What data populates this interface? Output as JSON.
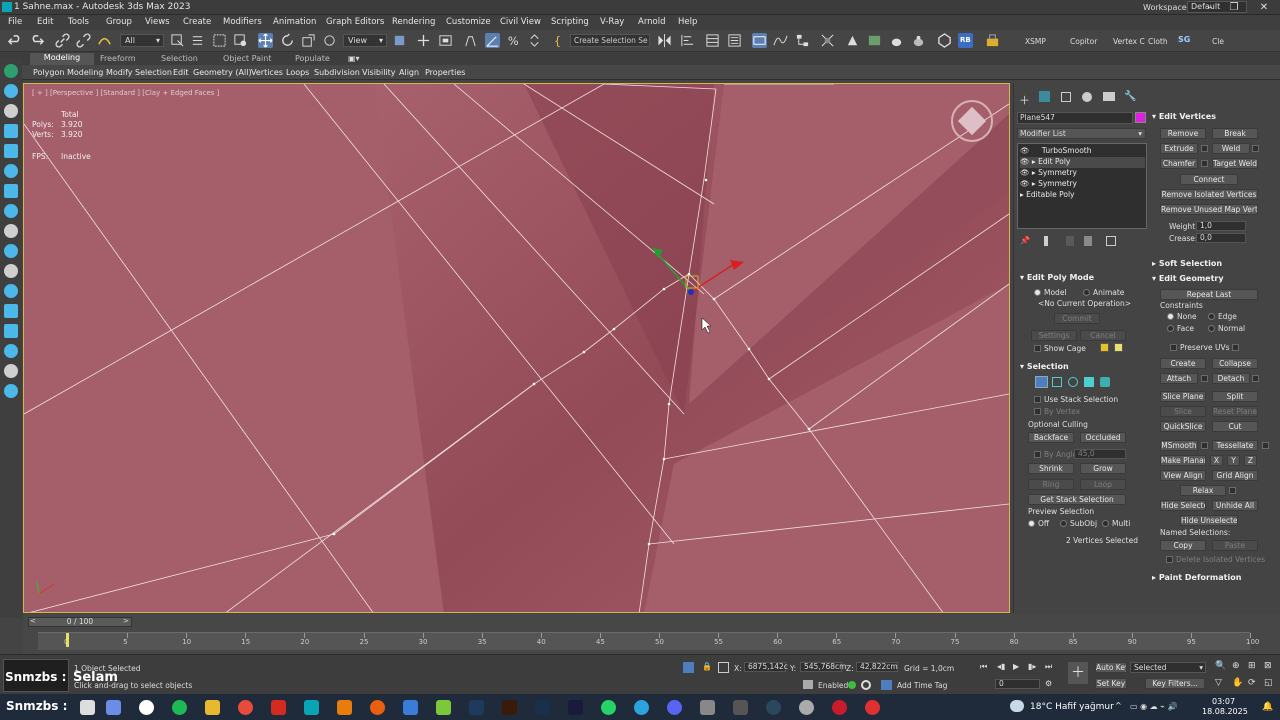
{
  "window": {
    "title": "1 Sahne.max - Autodesk 3ds Max 2023",
    "workspaces_label": "Workspaces:",
    "workspace_value": "Default"
  },
  "menu": [
    "File",
    "Edit",
    "Tools",
    "Group",
    "Views",
    "Create",
    "Modifiers",
    "Animation",
    "Graph Editors",
    "Rendering",
    "Customize",
    "Civil View",
    "Scripting",
    "V-Ray",
    "Arnold",
    "Help"
  ],
  "toolbar": {
    "filter_value": "All",
    "view_value": "View",
    "selection_set_placeholder": "Create Selection Se",
    "xsmp": "XSMP",
    "copitor": "Copitor",
    "vertex": "Vertex C",
    "cloth": "Cloth",
    "cle": "Cle",
    "rb": "RB"
  },
  "ribbon_tabs": [
    "Modeling",
    "Freeform",
    "Selection",
    "Object Paint",
    "Populate"
  ],
  "ribbon_sub": [
    "Polygon Modeling",
    "Modify Selection",
    "Edit",
    "Geometry (All)",
    "Vertices",
    "Loops",
    "Subdivision",
    "Visibility",
    "Align",
    "Properties"
  ],
  "viewport": {
    "label": "[ + ] [Perspective ] [Standard ] [Clay + Edged Faces ]",
    "total_label": "Total",
    "polys_label": "Polys:",
    "polys_value": "3.920",
    "verts_label": "Verts:",
    "verts_value": "3.920",
    "fps_label": "FPS:",
    "fps_value": "Inactive",
    "bg_color": "#a05a66"
  },
  "command_panel": {
    "object_name": "Plane547",
    "object_color": "#e020e0",
    "modifier_list": "Modifier List",
    "stack": [
      "TurboSmooth",
      "Edit Poly",
      "Symmetry",
      "Symmetry",
      "Editable Poly"
    ],
    "edit_poly_mode": {
      "title": "Edit Poly Mode",
      "model": "Model",
      "animate": "Animate",
      "current_op": "<No Current Operation>",
      "commit": "Commit",
      "settings": "Settings",
      "cancel": "Cancel",
      "show_cage": "Show Cage"
    },
    "selection": {
      "title": "Selection",
      "use_stack": "Use Stack Selection",
      "by_vertex": "By Vertex",
      "optional_culling": "Optional Culling",
      "backface": "Backface",
      "occluded": "Occluded",
      "by_angle": "By Angle:",
      "by_angle_value": "45,0",
      "shrink": "Shrink",
      "grow": "Grow",
      "ring": "Ring",
      "loop": "Loop",
      "get_stack": "Get Stack Selection",
      "preview": "Preview Selection",
      "off": "Off",
      "subobj": "SubObj",
      "multi": "Multi",
      "status": "2 Vertices Selected"
    }
  },
  "rollouts": {
    "edit_vertices": {
      "title": "Edit Vertices",
      "remove": "Remove",
      "break": "Break",
      "extrude": "Extrude",
      "weld": "Weld",
      "chamfer": "Chamfer",
      "target_weld": "Target Weld",
      "connect": "Connect",
      "remove_isolated": "Remove Isolated Vertices",
      "remove_unused": "Remove Unused Map Verts",
      "weight_label": "Weight:",
      "weight_value": "1,0",
      "crease_label": "Crease:",
      "crease_value": "0,0"
    },
    "soft_selection": "Soft Selection",
    "edit_geometry": {
      "title": "Edit Geometry",
      "repeat_last": "Repeat Last",
      "constraints": "Constraints",
      "none": "None",
      "edge": "Edge",
      "face": "Face",
      "normal": "Normal",
      "preserve_uvs": "Preserve UVs",
      "create": "Create",
      "collapse": "Collapse",
      "attach": "Attach",
      "detach": "Detach",
      "slice_plane": "Slice Plane",
      "split": "Split",
      "slice": "Slice",
      "reset_plane": "Reset Plane",
      "quickslice": "QuickSlice",
      "cut": "Cut",
      "msmooth": "MSmooth",
      "tessellate": "Tessellate",
      "make_planar": "Make Planar",
      "x": "X",
      "y": "Y",
      "z": "Z",
      "view_align": "View Align",
      "grid_align": "Grid Align",
      "relax": "Relax",
      "hide_selected": "Hide Selected",
      "unhide_all": "Unhide All",
      "hide_unselected": "Hide Unselected",
      "named_selections": "Named Selections:",
      "copy": "Copy",
      "paste": "Paste",
      "delete_isolated": "Delete Isolated Vertices"
    },
    "paint_deformation": "Paint Deformation"
  },
  "timeline": {
    "frame_counter": "0 / 100",
    "ticks": [
      "0",
      "5",
      "10",
      "15",
      "20",
      "25",
      "30",
      "35",
      "40",
      "45",
      "50",
      "55",
      "60",
      "65",
      "70",
      "75",
      "80",
      "85",
      "90",
      "95",
      "100"
    ]
  },
  "status": {
    "selected": "1 Object Selected",
    "hint": "Click and-drag to select objects",
    "x_label": "X:",
    "x_value": "6875,142c",
    "y_label": "Y:",
    "y_value": "545,768cm",
    "z_label": "Z:",
    "z_value": "42,822cm",
    "grid": "Grid = 1,0cm",
    "enabled": "Enabled:",
    "add_time_tag": "Add Time Tag",
    "auto_key": "Auto Key",
    "set_key": "Set Key",
    "selected_dd": "Selected",
    "key_filters": "Key Filters...",
    "frame_value": "0"
  },
  "overlay": {
    "script_name": "Snmzbs :",
    "greeting": "Selam"
  },
  "taskbar": {
    "label": "Snmzbs :",
    "weather": "18°C  Hafif yağmur",
    "time": "03:07",
    "date": "18.08.2025"
  }
}
